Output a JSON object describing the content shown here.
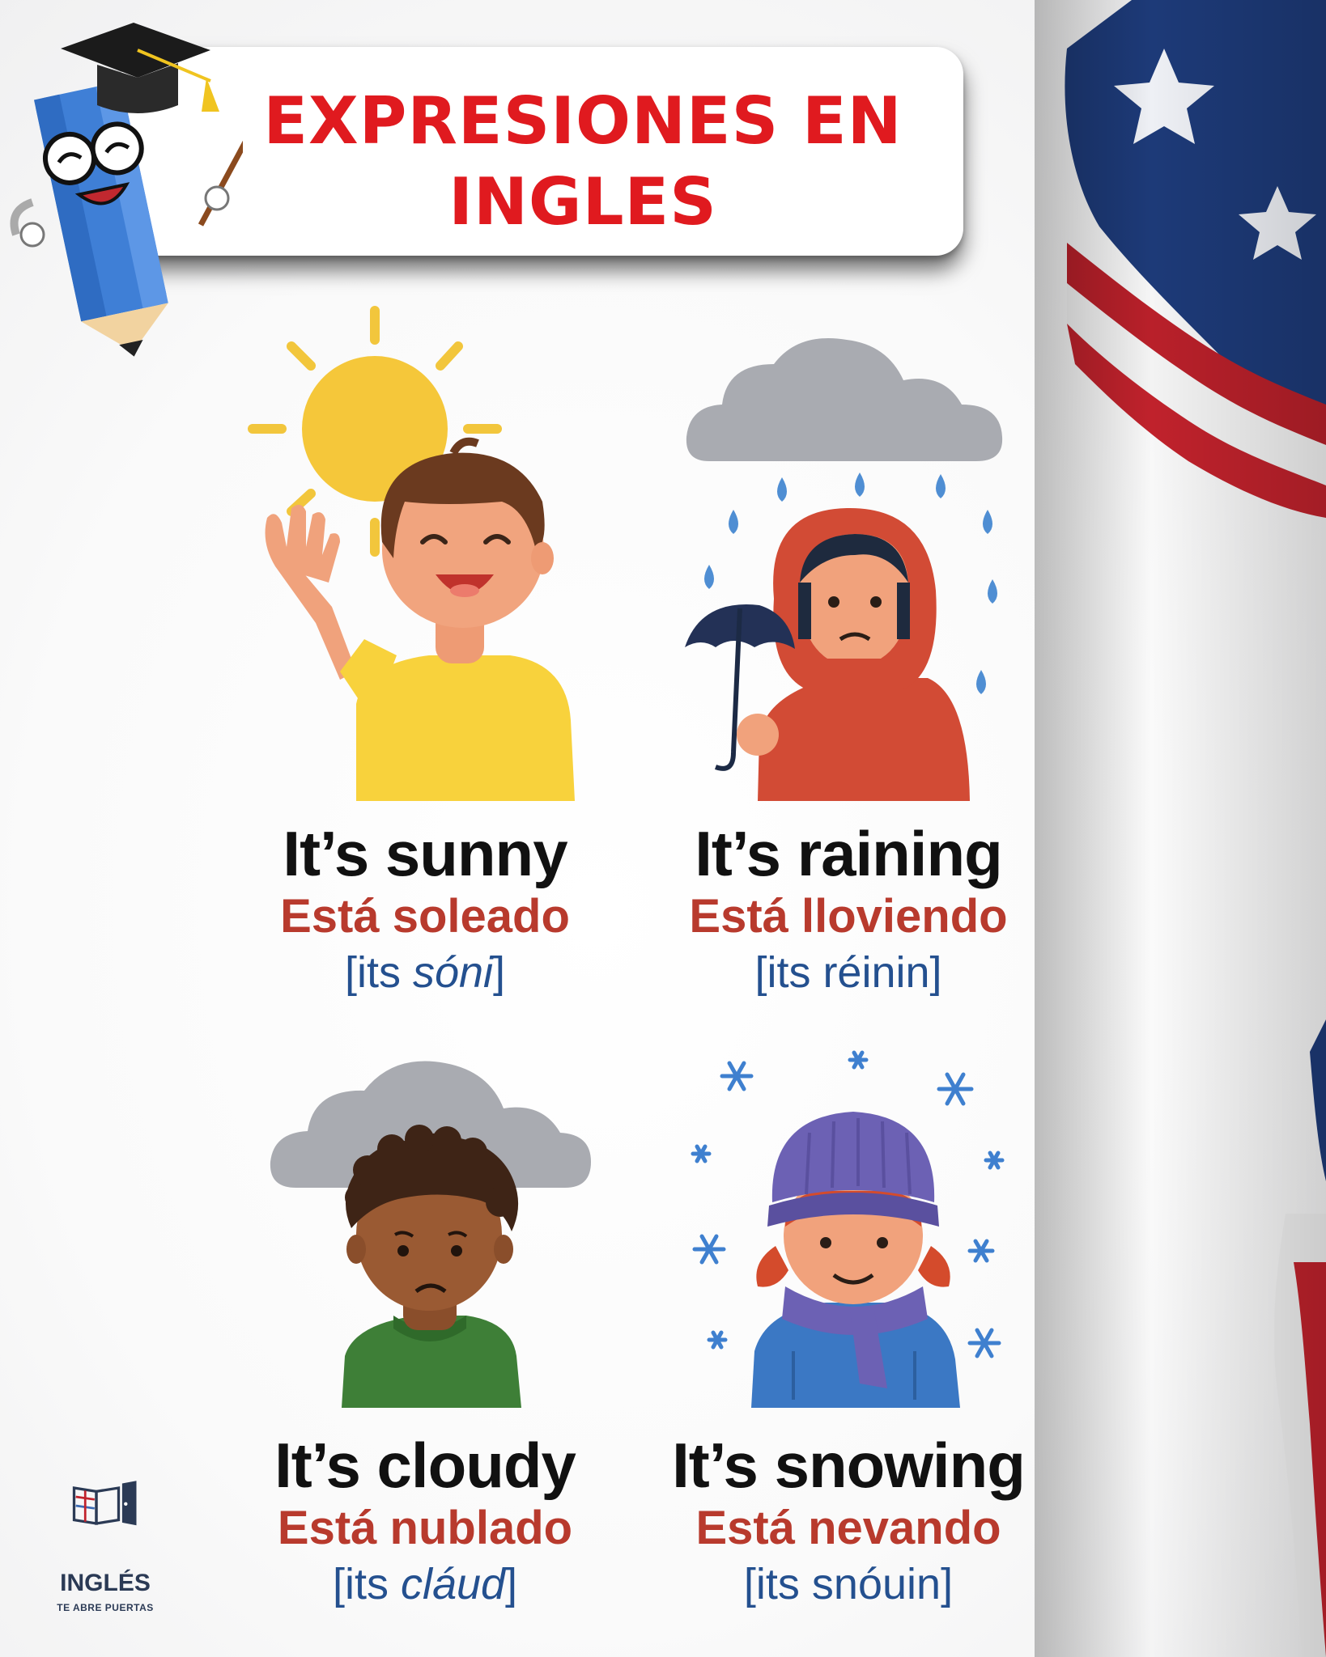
{
  "header": {
    "title_line1": "EXPRESIONES EN",
    "title_line2": "INGLES"
  },
  "cards": [
    {
      "english": "It’s sunny",
      "spanish": "Está soleado",
      "pron_open": "[its ",
      "pron_word": "sóni",
      "pron_close": "]"
    },
    {
      "english": "It’s raining",
      "spanish": "Está lloviendo",
      "pron_open": "[its ",
      "pron_word": "réinin",
      "pron_close": "]"
    },
    {
      "english": "It’s cloudy",
      "spanish": "Está nublado",
      "pron_open": "[its ",
      "pron_word": "cláud",
      "pron_close": "]"
    },
    {
      "english": "It’s snowing",
      "spanish": "Está nevando",
      "pron_open": "[its ",
      "pron_word": "snóuin",
      "pron_close": "]"
    }
  ],
  "logo": {
    "name": "INGLÉS",
    "tagline": "TE ABRE PUERTAS"
  },
  "colors": {
    "title_red": "#e01a1f",
    "spanish_red": "#b83a2d",
    "pron_blue": "#24508f",
    "english_black": "#111111"
  }
}
